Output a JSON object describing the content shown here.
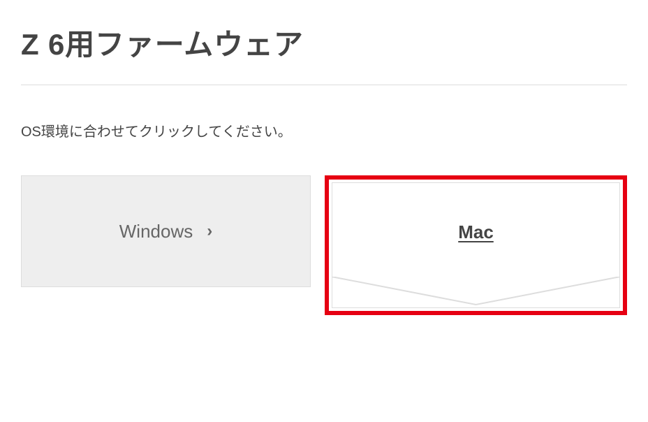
{
  "page": {
    "title": "Z 6用ファームウェア",
    "instruction": "OS環境に合わせてクリックしてください。"
  },
  "tabs": {
    "windows": {
      "label": "Windows"
    },
    "mac": {
      "label": "Mac"
    }
  }
}
